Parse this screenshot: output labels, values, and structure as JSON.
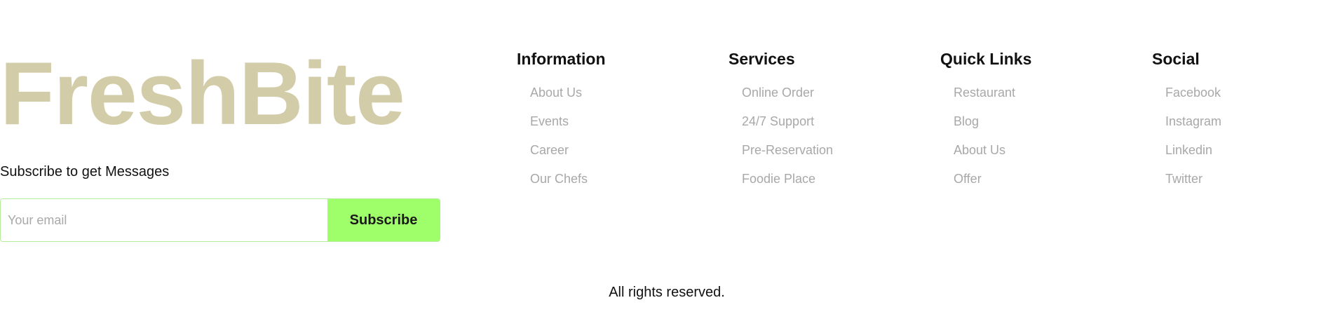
{
  "brand": {
    "logo_text": "FreshBite",
    "logo_color": "#d2cca8"
  },
  "subscribe": {
    "caption": "Subscribe to get Messages",
    "email_placeholder": "Your email",
    "email_value": "",
    "button_label": "Subscribe",
    "button_color": "#9eff6b",
    "border_color": "#b5ec9c"
  },
  "columns": [
    {
      "title": "Information",
      "links": [
        "About Us",
        "Events",
        "Career",
        "Our Chefs"
      ]
    },
    {
      "title": "Services",
      "links": [
        "Online Order",
        "24/7 Support",
        "Pre-Reservation",
        "Foodie Place"
      ]
    },
    {
      "title": "Quick Links",
      "links": [
        "Restaurant",
        "Blog",
        "About Us",
        "Offer"
      ]
    },
    {
      "title": "Social",
      "links": [
        "Facebook",
        "Instagram",
        "Linkedin",
        "Twitter"
      ]
    }
  ],
  "footer": {
    "copyright": "All rights reserved."
  },
  "colors": {
    "link": "#a8a8a8",
    "heading": "#111111",
    "background": "#ffffff"
  }
}
